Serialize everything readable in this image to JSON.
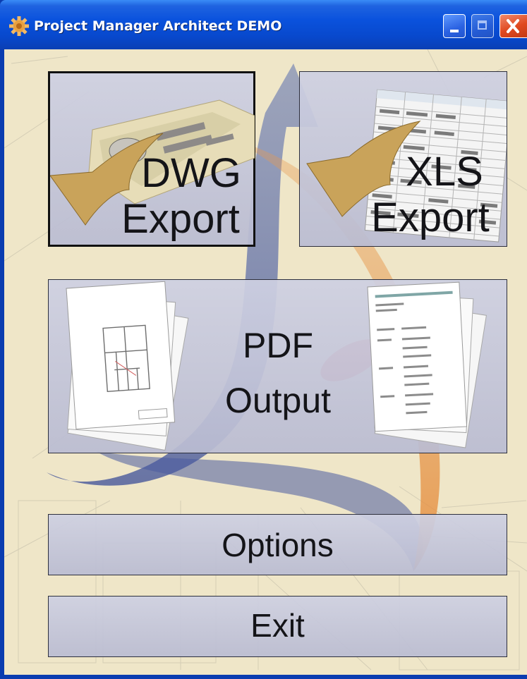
{
  "window": {
    "title": "Project Manager Architect DEMO",
    "colors": {
      "titlebar": "#0a52dd",
      "close": "#e0491f",
      "client_bg": "#efe6c8",
      "button_face": "#c6c8dc"
    },
    "icons": [
      "gear-app-icon",
      "minimize-icon",
      "maximize-icon",
      "close-icon"
    ]
  },
  "buttons": {
    "dwg": {
      "line1": "DWG",
      "line2": "Export"
    },
    "xls": {
      "line1": "XLS",
      "line2": "Export"
    },
    "pdf": {
      "line1": "PDF",
      "line2": "Output"
    },
    "options": "Options",
    "exit": "Exit"
  }
}
